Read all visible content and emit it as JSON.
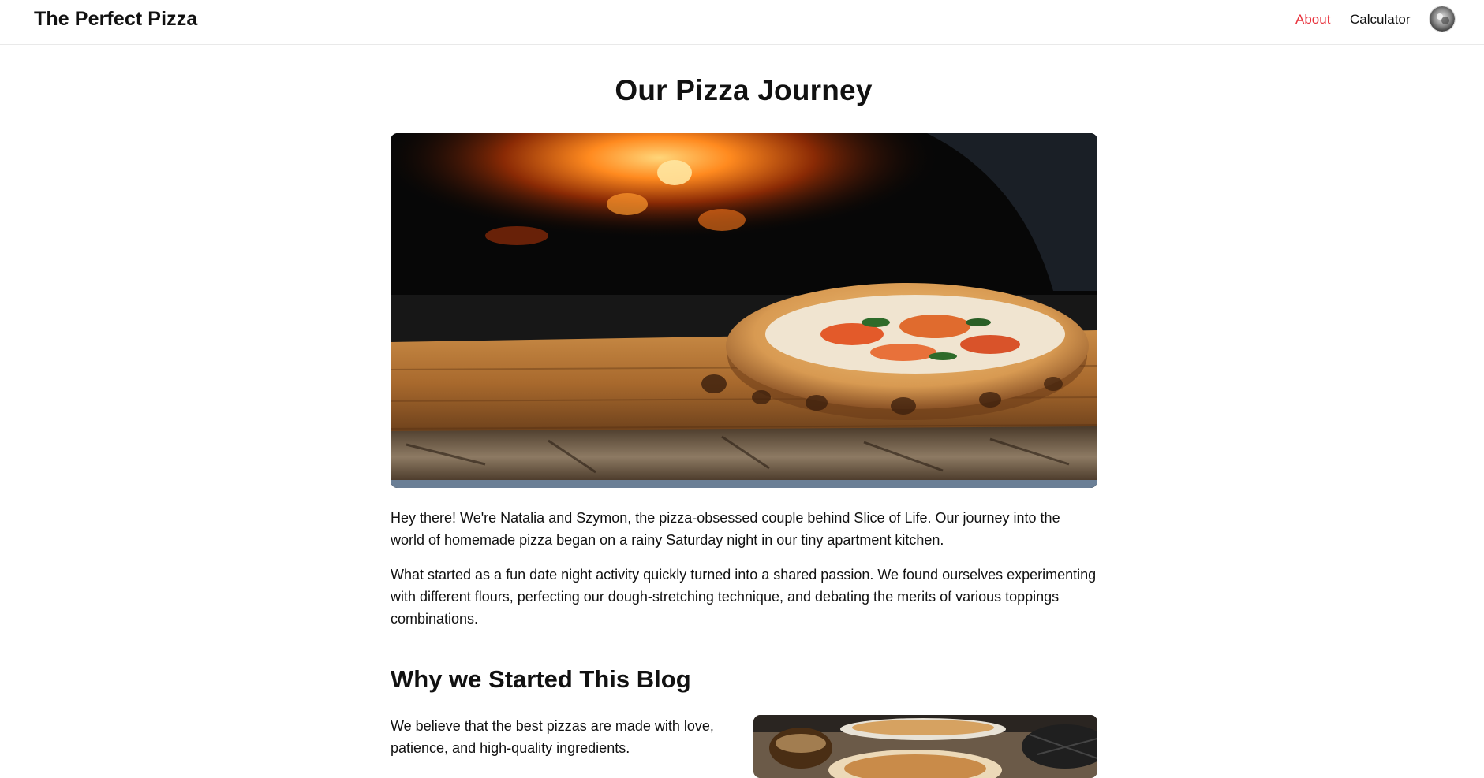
{
  "header": {
    "brand": "The Perfect Pizza",
    "nav": [
      {
        "label": "About",
        "active": true
      },
      {
        "label": "Calculator",
        "active": false
      }
    ],
    "avatar_icon": "user-avatar"
  },
  "main": {
    "title": "Our Pizza Journey",
    "hero_image": "pizza-on-wooden-board-in-wood-fired-oven",
    "paragraphs": [
      "Hey there! We're Natalia and Szymon, the pizza-obsessed couple behind Slice of Life. Our journey into the world of homemade pizza began on a rainy Saturday night in our tiny apartment kitchen.",
      "What started as a fun date night activity quickly turned into a shared passion. We found ourselves experimenting with different flours, perfecting our dough-stretching technique, and debating the merits of various toppings combinations."
    ],
    "section": {
      "title": "Why we Started This Blog",
      "text": "We believe that the best pizzas are made with love, patience, and high-quality ingredients.",
      "image": "pizzas-and-drinks-on-table"
    }
  },
  "colors": {
    "accent": "#e8323c",
    "text": "#111111",
    "border": "#e9e9e9"
  }
}
